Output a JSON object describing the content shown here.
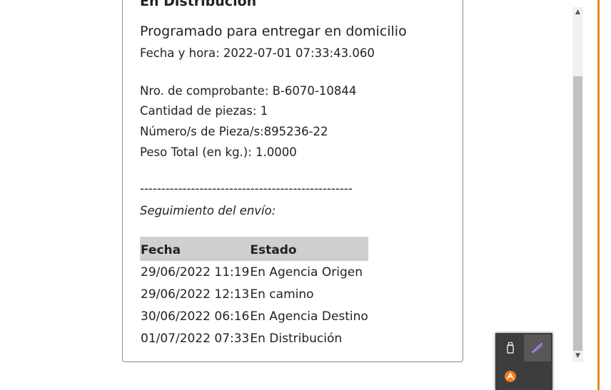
{
  "shipment": {
    "status_heading": "En Distribución",
    "status_detail": "Programado para entregar en domicilio",
    "datetime_line": "Fecha y hora: 2022-07-01 07:33:43.060",
    "receipt": "Nro. de comprobante: B-6070-10844",
    "pieces_count": "Cantidad de piezas: 1",
    "piece_numbers": "Número/s de Pieza/s:895236-22",
    "weight": "Peso Total (en kg.): 1.0000",
    "separator": "--------------------------------------------------",
    "tracking_label": "Seguimiento del envío:"
  },
  "tracking_table": {
    "headers": [
      "Fecha",
      "Estado"
    ],
    "rows": [
      {
        "fecha": "29/06/2022 11:19",
        "estado": "En Agencia Origen"
      },
      {
        "fecha": "29/06/2022 12:13",
        "estado": "En camino"
      },
      {
        "fecha": "30/06/2022 06:16",
        "estado": "En Agencia Destino"
      },
      {
        "fecha": "01/07/2022 07:33",
        "estado": "En Distribución"
      }
    ]
  },
  "tray_icons": [
    "usb-drive-icon",
    "pen-icon",
    "app-icon"
  ],
  "colors": {
    "accent": "#e8851e",
    "header_bg": "#cfcfcf",
    "tray_bg": "#3d3d3d"
  }
}
